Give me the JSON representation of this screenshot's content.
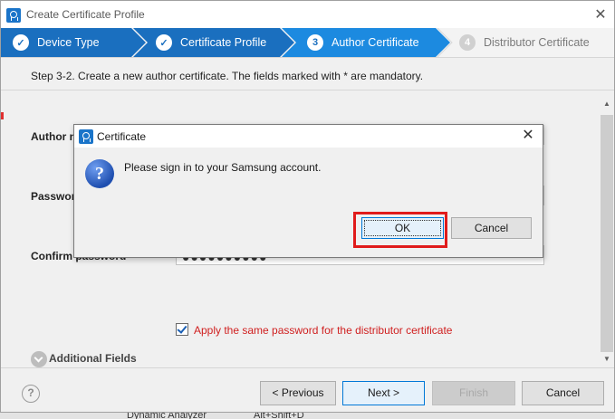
{
  "window": {
    "title": "Create Certificate Profile",
    "close_glyph": "✕"
  },
  "steps": [
    {
      "label": "Device Type",
      "state": "done",
      "marker": "✓"
    },
    {
      "label": "Certificate Profile",
      "state": "done",
      "marker": "✓"
    },
    {
      "label": "Author Certificate",
      "state": "active",
      "marker": "3"
    },
    {
      "label": "Distributor Certificate",
      "state": "todo",
      "marker": "4"
    }
  ],
  "colors": {
    "step_done": "#1a6fbf",
    "step_active": "#1c8ae0",
    "highlight": "#e01b1b",
    "mandatory_text": "#d02020"
  },
  "instruction": "Step 3-2. Create a new author certificate. The fields marked with * are mandatory.",
  "form": {
    "author_name_label": "Author n",
    "password_label": "Passwor",
    "confirm_password_label": "Confirm password*",
    "confirm_password_value": "●●●●●●●●●●",
    "apply_same_password_label": "Apply the same password for the distributor certificate",
    "apply_same_password_checked": true,
    "additional_fields_label": "Additional Fields"
  },
  "buttons": {
    "help": "?",
    "previous": "< Previous",
    "next": "Next >",
    "finish": "Finish",
    "cancel": "Cancel"
  },
  "dialog": {
    "title": "Certificate",
    "close_glyph": "✕",
    "icon": "question-icon",
    "icon_glyph": "?",
    "message": "Please sign in to your Samsung account.",
    "ok_label": "OK",
    "cancel_label": "Cancel"
  },
  "background": {
    "fragment_text_1": "Dynamic Analyzer",
    "fragment_text_2": "Alt+Shift+D"
  }
}
